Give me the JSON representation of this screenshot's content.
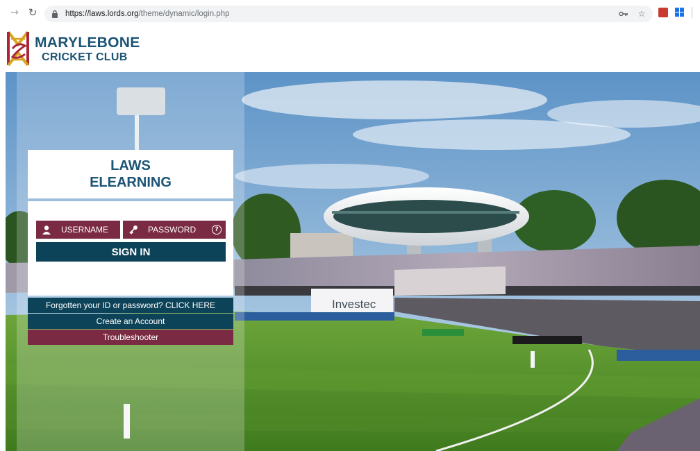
{
  "browser": {
    "url_scheme_host": "https://laws.lords.org",
    "url_path": "/theme/dynamic/login.php",
    "icons": [
      "back-arrow-icon",
      "reload-icon",
      "lock-icon",
      "key-icon",
      "star-icon",
      "pdf-extension-icon",
      "windows-extension-icon"
    ]
  },
  "header": {
    "brand_line1": "MARYLEBONE",
    "brand_line2": "CRICKET CLUB"
  },
  "login": {
    "title_line1": "LAWS",
    "title_line2": "ELEARNING",
    "username_placeholder": "USERNAME",
    "password_placeholder": "PASSWORD",
    "signin_label": "SIGN IN",
    "forgot_label": "Forgotten your ID or password? CLICK HERE",
    "create_label": "Create an Account",
    "trouble_label": "Troubleshooter"
  },
  "hero": {
    "banner_text": "Investec"
  },
  "colors": {
    "brand_blue": "#1c5475",
    "dark_teal": "#0d4358",
    "maroon": "#7a2a43"
  }
}
